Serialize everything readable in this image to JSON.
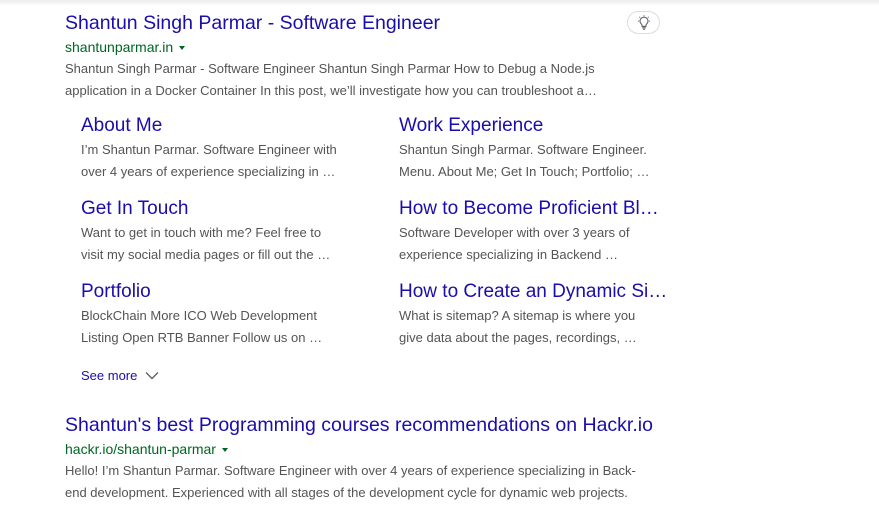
{
  "result1": {
    "title": "Shantun Singh Parmar - Software Engineer",
    "url": "shantunparmar.in",
    "snippet_line1": "Shantun Singh Parmar - Software Engineer Shantun Singh Parmar How to Debug a Node.js",
    "snippet_line2": "application in a Docker Container In this post, we’ll investigate how you can troubleshoot a…",
    "bulb_icon": "lightbulb-icon"
  },
  "sitelinks": [
    {
      "title": "About Me",
      "line1": "I’m Shantun Parmar. Software Engineer with",
      "line2": "over 4 years of experience specializing in …"
    },
    {
      "title": "Work Experience",
      "line1": "Shantun Singh Parmar. Software Engineer.",
      "line2": "Menu. About Me; Get In Touch; Portfolio; …"
    },
    {
      "title": "Get In Touch",
      "line1": "Want to get in touch with me? Feel free to",
      "line2": "visit my social media pages or fill out the …"
    },
    {
      "title": "How to Become Proficient Bl…",
      "line1": "Software Developer with over 3 years of",
      "line2": "experience specializing in Backend …"
    },
    {
      "title": "Portfolio",
      "line1": "BlockChain More ICO Web Development",
      "line2": "Listing Open RTB Banner Follow us on …"
    },
    {
      "title": "How to Create an Dynamic Si…",
      "line1": "What is sitemap? A sitemap is where you",
      "line2": "give data about the pages, recordings, …"
    }
  ],
  "see_more": {
    "label": "See more",
    "icon": "chevron-down-icon"
  },
  "result2": {
    "title": "Shantun's best Programming courses recommendations on Hackr.io",
    "url": "hackr.io/shantun-parmar",
    "snippet_line1": "Hello! I’m Shantun Parmar. Software Engineer with over 4 years of experience specializing in Back-",
    "snippet_line2": "end development. Experienced with all stages of the development cycle for dynamic web projects."
  },
  "colors": {
    "link": "#1a0dab",
    "url": "#006621",
    "snippet": "#545454"
  }
}
